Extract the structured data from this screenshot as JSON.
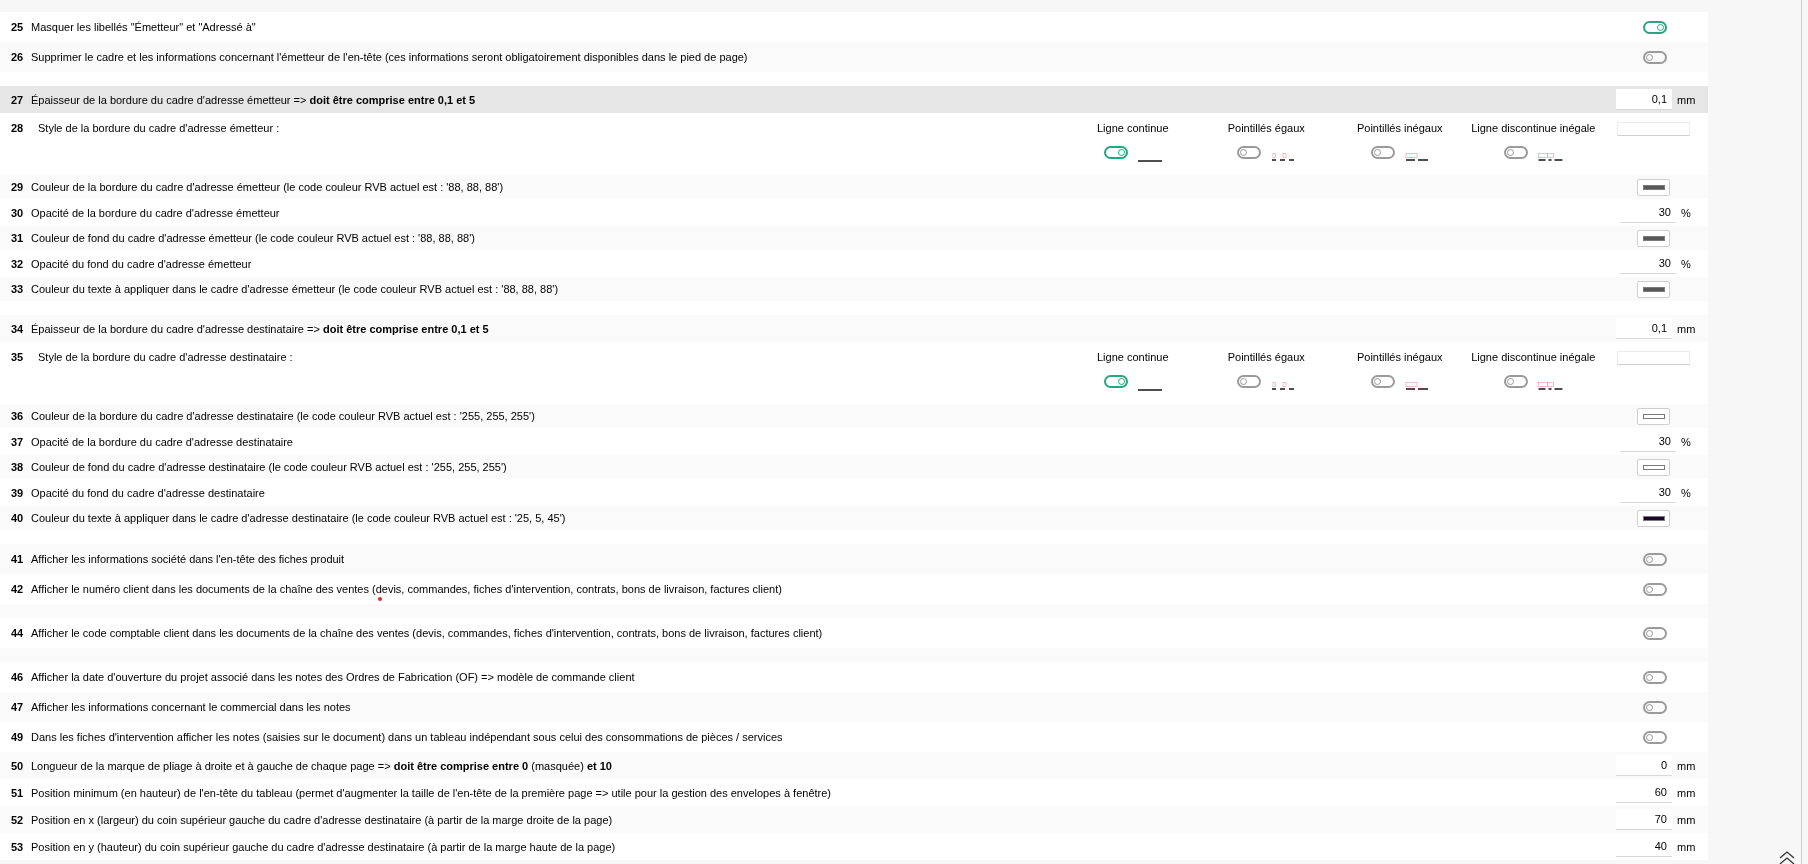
{
  "sections": [
    {
      "rows": [
        {
          "num": "25",
          "kind": "toggle",
          "label": "Masquer les libellés \"Émetteur\" et \"Adressé à\"",
          "on": true,
          "highlighted": false,
          "marked": false
        },
        {
          "num": "26",
          "kind": "toggle",
          "label": "Supprimer le cadre et les informations concernant l'émetteur de l'en-tête (ces informations seront obligatoirement disponibles dans le pied de page)",
          "on": false,
          "highlighted": false,
          "marked": false
        }
      ]
    },
    {
      "rows": [
        {
          "num": "27",
          "kind": "number",
          "label": "Épaisseur de la bordure du cadre d'adresse émetteur => **doit être comprise entre 0,1 et 5**",
          "value": "0,1",
          "unit": "mm",
          "highlighted": true,
          "marked": false
        },
        {
          "num": "28",
          "kind": "style",
          "label": "Style de la bordure du cadre d'adresse émetteur :",
          "options": [
            {
              "label": "Ligne continue",
              "kind": "solid",
              "selected": true
            },
            {
              "label": "Pointillés égaux",
              "kind": "dotted",
              "selected": false
            },
            {
              "label": "Pointillés inégaux",
              "kind": "uneven",
              "selected": false
            },
            {
              "label": "Ligne discontinue inégale",
              "kind": "dashdot",
              "selected": false
            }
          ],
          "highlighted": false,
          "marked": false
        },
        {
          "num": "29",
          "kind": "color",
          "label": "Couleur de la bordure du cadre d'adresse émetteur (le code couleur RVB actuel est : '88, 88, 88')",
          "color": "#585858",
          "highlighted": false,
          "marked": false
        },
        {
          "num": "30",
          "kind": "number",
          "label": "Opacité de la bordure du cadre d'adresse émetteur",
          "value": "30",
          "unit": "%",
          "highlighted": false,
          "marked": false
        },
        {
          "num": "31",
          "kind": "color",
          "label": "Couleur de fond du cadre d'adresse émetteur (le code couleur RVB actuel est : '88, 88, 88')",
          "color": "#585858",
          "highlighted": false,
          "marked": false
        },
        {
          "num": "32",
          "kind": "number",
          "label": "Opacité du fond du cadre d'adresse émetteur",
          "value": "30",
          "unit": "%",
          "highlighted": false,
          "marked": false
        },
        {
          "num": "33",
          "kind": "color",
          "label": "Couleur du texte à appliquer dans le cadre d'adresse émetteur (le code couleur RVB actuel est : '88, 88, 88')",
          "color": "#585858",
          "highlighted": false,
          "marked": false
        }
      ]
    },
    {
      "rows": [
        {
          "num": "34",
          "kind": "number",
          "label": "Épaisseur de la bordure du cadre d'adresse destinataire => **doit être comprise entre 0,1 et 5**",
          "value": "0,1",
          "unit": "mm",
          "highlighted": false,
          "marked": false
        },
        {
          "num": "35",
          "kind": "style",
          "label": "Style de la bordure du cadre d'adresse destinataire :",
          "options": [
            {
              "label": "Ligne continue",
              "kind": "solid",
              "selected": true
            },
            {
              "label": "Pointillés égaux",
              "kind": "dotted",
              "selected": false
            },
            {
              "label": "Pointillés inégaux",
              "kind": "uneven",
              "selected": false
            },
            {
              "label": "Ligne discontinue inégale",
              "kind": "dashdot",
              "selected": false
            }
          ],
          "highlighted": false,
          "marked": false
        },
        {
          "num": "36",
          "kind": "color",
          "label": "Couleur de la bordure du cadre d'adresse destinataire (le code couleur RVB actuel est : '255, 255, 255')",
          "color": "#ffffff",
          "highlighted": false,
          "marked": false
        },
        {
          "num": "37",
          "kind": "number",
          "label": "Opacité de la bordure du cadre d'adresse destinataire",
          "value": "30",
          "unit": "%",
          "highlighted": false,
          "marked": false
        },
        {
          "num": "38",
          "kind": "color",
          "label": "Couleur de fond du cadre d'adresse destinataire (le code couleur RVB actuel est : '255, 255, 255')",
          "color": "#ffffff",
          "highlighted": false,
          "marked": false
        },
        {
          "num": "39",
          "kind": "number",
          "label": "Opacité du fond du cadre d'adresse destinataire",
          "value": "30",
          "unit": "%",
          "highlighted": false,
          "marked": false
        },
        {
          "num": "40",
          "kind": "color",
          "label": "Couleur du texte à appliquer dans le cadre d'adresse destinataire (le code couleur RVB actuel est : '25, 5, 45')",
          "color": "#19052d",
          "highlighted": false,
          "marked": false
        }
      ]
    },
    {
      "rows": [
        {
          "num": "41",
          "kind": "toggle",
          "label": "Afficher les informations société dans l'en-tête des fiches produit",
          "on": false,
          "highlighted": false,
          "marked": false
        },
        {
          "num": "42",
          "kind": "toggle",
          "label": "Afficher le numéro client dans les documents de la chaîne des ventes (devis, commandes, fiches d'intervention, contrats, bons de livraison, factures client)",
          "on": false,
          "highlighted": false,
          "marked": true
        }
      ]
    },
    {
      "rows": [
        {
          "num": "44",
          "kind": "toggle",
          "label": "Afficher le code comptable client dans les documents de la chaîne des ventes (devis, commandes, fiches d'intervention, contrats, bons de livraison, factures client)",
          "on": false,
          "highlighted": false,
          "marked": false
        }
      ]
    },
    {
      "rows": [
        {
          "num": "46",
          "kind": "toggle",
          "label": "Afficher la date d'ouverture du projet associé dans les notes des Ordres de Fabrication (OF) => modèle de commande client",
          "on": false,
          "highlighted": false,
          "marked": false
        },
        {
          "num": "47",
          "kind": "toggle",
          "label": "Afficher les informations concernant le commercial dans les notes",
          "on": false,
          "highlighted": false,
          "marked": false
        },
        {
          "num": "49",
          "kind": "toggle",
          "label": "Dans les fiches d'intervention afficher les notes (saisies sur le document) dans un tableau indépendant sous celui des consommations de pièces / services",
          "on": false,
          "highlighted": false,
          "marked": false
        },
        {
          "num": "50",
          "kind": "number",
          "label": "Longueur de la marque de pliage à droite et à gauche de chaque page => **doit être comprise entre 0** (masquée) **et 10**",
          "value": "0",
          "unit": "mm",
          "highlighted": false,
          "marked": false
        },
        {
          "num": "51",
          "kind": "number",
          "label": "Position minimum (en hauteur) de l'en-tête du tableau (permet d'augmenter la taille de l'en-tête de la première page => utile pour la gestion des envelopes à fenêtre)",
          "value": "60",
          "unit": "mm",
          "highlighted": false,
          "marked": false
        },
        {
          "num": "52",
          "kind": "number",
          "label": "Position en x (largeur) du coin supérieur gauche du cadre d'adresse destinataire (à partir de la marge droite de la page)",
          "value": "70",
          "unit": "mm",
          "highlighted": false,
          "marked": false
        },
        {
          "num": "53",
          "kind": "number",
          "label": "Position en y (hauteur) du coin supérieur gauche du cadre d'adresse destinataire (à partir de la marge haute de la page)",
          "value": "40",
          "unit": "mm",
          "highlighted": false,
          "marked": false
        }
      ]
    }
  ]
}
